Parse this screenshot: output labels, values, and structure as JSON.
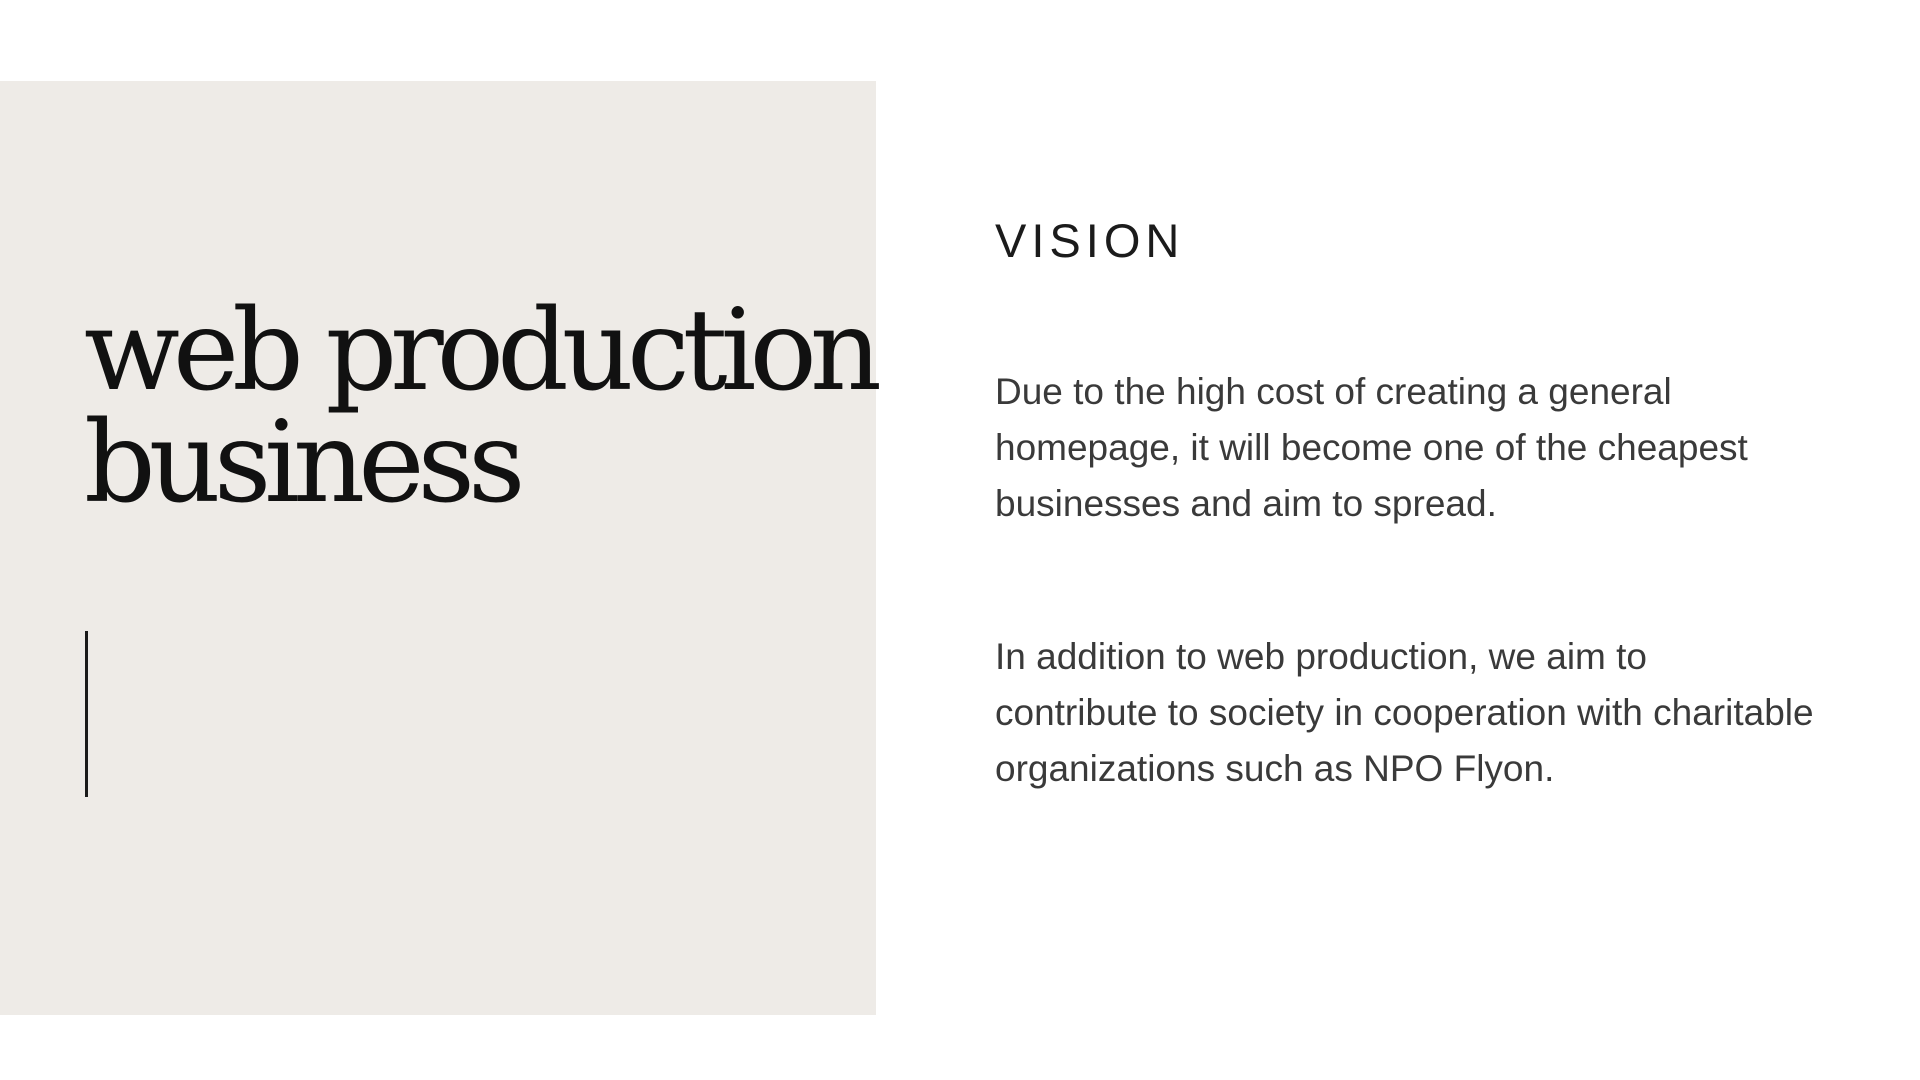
{
  "left_panel": {
    "title_line_1": "web production",
    "title_line_2": "business"
  },
  "vision": {
    "heading": "VISION",
    "paragraph_1": "Due to the high cost of creating a general homepage, it will become one of the cheapest businesses and aim to spread.",
    "paragraph_2": "In addition to web production, we aim to contribute to society in cooperation with charitable organizations such as NPO Flyon."
  },
  "colors": {
    "panel_background": "#eeebe7",
    "title_text": "#111111",
    "body_text": "#3a3a3a",
    "accent_line": "#1a1a1a"
  }
}
